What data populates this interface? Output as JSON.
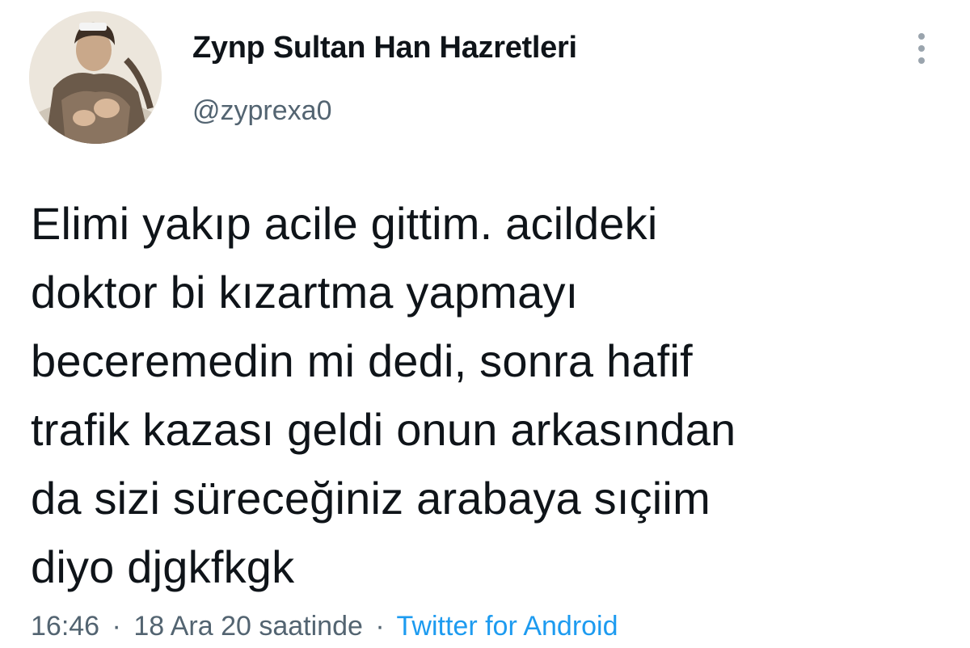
{
  "author": {
    "display_name": "Zynp Sultan Han Hazretleri",
    "handle": "@zyprexa0",
    "avatar_icon": "profile-photo"
  },
  "menu": {
    "icon": "vertical-dots-icon"
  },
  "tweet": {
    "lines": [
      "Elimi yakıp acile gittim. acildeki",
      "doktor bi kızartma yapmayı",
      "beceremedin mi dedi, sonra hafif",
      "trafik kazası geldi onun arkasından",
      "da sizi süreceğiniz arabaya sıçiim",
      "diyo djgkfkgk"
    ]
  },
  "meta": {
    "time": "16:46",
    "separator": "·",
    "date": "18 Ara 20 saatinde",
    "source": "Twitter for Android"
  },
  "colors": {
    "text_primary": "#0f1419",
    "text_secondary": "#536471",
    "link": "#1d9bf0"
  }
}
